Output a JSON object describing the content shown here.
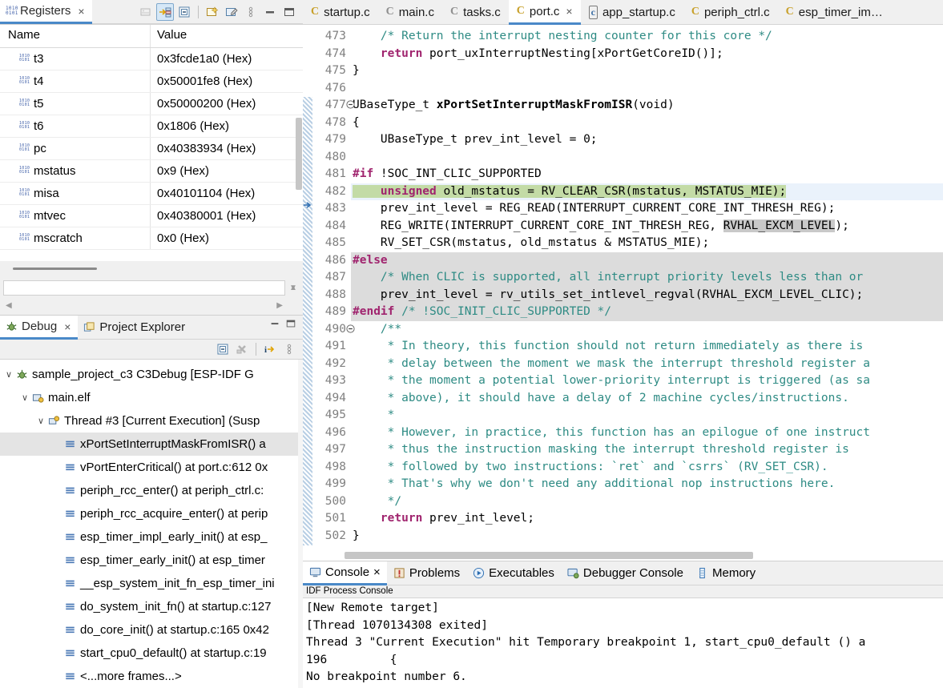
{
  "registers_view": {
    "tab_label": "Registers",
    "close_label": "×",
    "columns": {
      "name": "Name",
      "value": "Value"
    },
    "toolbar": [
      {
        "name": "collapse-registers-icon",
        "title": "Collapse All"
      },
      {
        "name": "show-type-names-icon",
        "title": "Show Type Names"
      },
      {
        "name": "collapse-all-icon",
        "title": "Collapse"
      },
      {
        "name": "new-register-group-icon",
        "title": "New Register Group"
      },
      {
        "name": "edit-register-group-icon",
        "title": "Edit Register Group"
      },
      {
        "name": "view-menu-icon",
        "title": "View Menu"
      },
      {
        "name": "minimize-icon",
        "title": "Minimize"
      },
      {
        "name": "maximize-icon",
        "title": "Maximize"
      }
    ],
    "rows": [
      {
        "name": "t3",
        "value": "0x3fcde1a0 (Hex)"
      },
      {
        "name": "t4",
        "value": "0x50001fe8 (Hex)"
      },
      {
        "name": "t5",
        "value": "0x50000200 (Hex)"
      },
      {
        "name": "t6",
        "value": "0x1806 (Hex)"
      },
      {
        "name": "pc",
        "value": "0x40383934 (Hex)"
      },
      {
        "name": "mstatus",
        "value": "0x9 (Hex)"
      },
      {
        "name": "misa",
        "value": "0x40101104 (Hex)"
      },
      {
        "name": "mtvec",
        "value": "0x40380001 (Hex)"
      },
      {
        "name": "mscratch",
        "value": "0x0 (Hex)"
      }
    ]
  },
  "debug_view": {
    "tabs": [
      {
        "label": "Debug",
        "active": true,
        "icon": "bug-icon",
        "closeable": true
      },
      {
        "label": "Project Explorer",
        "active": false,
        "icon": "project-explorer-icon",
        "closeable": false
      }
    ],
    "close_label": "×",
    "toolbar": [
      {
        "name": "collapse-all-icon",
        "title": "Collapse All"
      },
      {
        "name": "remove-terminated-icon",
        "title": "Remove All Terminated"
      },
      {
        "name": "step-info-icon",
        "title": "Instruction Stepping Mode"
      },
      {
        "name": "view-menu-icon",
        "title": "View Menu"
      }
    ],
    "minimize_label": "–",
    "maximize_label": "▭",
    "tree": [
      {
        "indent": 0,
        "twisty": "∨",
        "icon": "launch-config-icon",
        "label": "sample_project_c3 C3Debug [ESP-IDF G",
        "selected": false
      },
      {
        "indent": 1,
        "twisty": "∨",
        "icon": "process-icon",
        "label": "main.elf",
        "selected": false
      },
      {
        "indent": 2,
        "twisty": "∨",
        "icon": "thread-icon",
        "label": "Thread #3 [Current Execution] (Susp",
        "selected": false
      },
      {
        "indent": 3,
        "twisty": "",
        "icon": "stack-frame-icon",
        "label": "xPortSetInterruptMaskFromISR() a",
        "selected": true
      },
      {
        "indent": 3,
        "twisty": "",
        "icon": "stack-frame-icon",
        "label": "vPortEnterCritical() at port.c:612 0x",
        "selected": false
      },
      {
        "indent": 3,
        "twisty": "",
        "icon": "stack-frame-icon",
        "label": "periph_rcc_enter() at periph_ctrl.c:",
        "selected": false
      },
      {
        "indent": 3,
        "twisty": "",
        "icon": "stack-frame-icon",
        "label": "periph_rcc_acquire_enter() at perip",
        "selected": false
      },
      {
        "indent": 3,
        "twisty": "",
        "icon": "stack-frame-icon",
        "label": "esp_timer_impl_early_init() at esp_",
        "selected": false
      },
      {
        "indent": 3,
        "twisty": "",
        "icon": "stack-frame-icon",
        "label": "esp_timer_early_init() at esp_timer",
        "selected": false
      },
      {
        "indent": 3,
        "twisty": "",
        "icon": "stack-frame-icon",
        "label": "__esp_system_init_fn_esp_timer_ini",
        "selected": false
      },
      {
        "indent": 3,
        "twisty": "",
        "icon": "stack-frame-icon",
        "label": "do_system_init_fn() at startup.c:127",
        "selected": false
      },
      {
        "indent": 3,
        "twisty": "",
        "icon": "stack-frame-icon",
        "label": "do_core_init() at startup.c:165 0x42",
        "selected": false
      },
      {
        "indent": 3,
        "twisty": "",
        "icon": "stack-frame-icon",
        "label": "start_cpu0_default() at startup.c:19",
        "selected": false
      },
      {
        "indent": 3,
        "twisty": "",
        "icon": "stack-frame-icon",
        "label": "<...more frames...>",
        "selected": false
      }
    ]
  },
  "editor": {
    "tabs": [
      {
        "label": "startup.c",
        "icon": "c-source-icon",
        "icon_color": "y",
        "active": false,
        "closeable": false
      },
      {
        "label": "main.c",
        "icon": "c-source-icon",
        "icon_color": "g",
        "active": false,
        "closeable": false
      },
      {
        "label": "tasks.c",
        "icon": "c-source-icon",
        "icon_color": "g",
        "active": false,
        "closeable": false
      },
      {
        "label": "port.c",
        "icon": "c-source-icon",
        "icon_color": "y",
        "active": true,
        "closeable": true
      },
      {
        "label": "app_startup.c",
        "icon": "c-file-icon",
        "icon_color": "b",
        "active": false,
        "closeable": false
      },
      {
        "label": "periph_ctrl.c",
        "icon": "c-source-icon",
        "icon_color": "y",
        "active": false,
        "closeable": false
      },
      {
        "label": "esp_timer_im…",
        "icon": "c-source-icon",
        "icon_color": "y",
        "active": false,
        "closeable": false
      }
    ],
    "close_label": "×",
    "first_line": 473,
    "lines": [
      {
        "n": 473,
        "text": "    /* Return the interrupt nesting counter for this core */"
      },
      {
        "n": 474,
        "text": "    return port_uxInterruptNesting[xPortGetCoreID()];"
      },
      {
        "n": 475,
        "text": "}"
      },
      {
        "n": 476,
        "text": ""
      },
      {
        "n": 477,
        "text": "UBaseType_t xPortSetInterruptMaskFromISR(void)"
      },
      {
        "n": 478,
        "text": "{"
      },
      {
        "n": 479,
        "text": "    UBaseType_t prev_int_level = 0;"
      },
      {
        "n": 480,
        "text": ""
      },
      {
        "n": 481,
        "text": "#if !SOC_INT_CLIC_SUPPORTED"
      },
      {
        "n": 482,
        "text": "    unsigned old_mstatus = RV_CLEAR_CSR(mstatus, MSTATUS_MIE);"
      },
      {
        "n": 483,
        "text": "    prev_int_level = REG_READ(INTERRUPT_CURRENT_CORE_INT_THRESH_REG);"
      },
      {
        "n": 484,
        "text": "    REG_WRITE(INTERRUPT_CURRENT_CORE_INT_THRESH_REG, RVHAL_EXCM_LEVEL);"
      },
      {
        "n": 485,
        "text": "    RV_SET_CSR(mstatus, old_mstatus & MSTATUS_MIE);"
      },
      {
        "n": 486,
        "text": "#else"
      },
      {
        "n": 487,
        "text": "    /* When CLIC is supported, all interrupt priority levels less than or "
      },
      {
        "n": 488,
        "text": "    prev_int_level = rv_utils_set_intlevel_regval(RVHAL_EXCM_LEVEL_CLIC);"
      },
      {
        "n": 489,
        "text": "#endif /* !SOC_INIT_CLIC_SUPPORTED */"
      },
      {
        "n": 490,
        "text": "    /**"
      },
      {
        "n": 491,
        "text": "     * In theory, this function should not return immediately as there is "
      },
      {
        "n": 492,
        "text": "     * delay between the moment we mask the interrupt threshold register a"
      },
      {
        "n": 493,
        "text": "     * the moment a potential lower-priority interrupt is triggered (as sa"
      },
      {
        "n": 494,
        "text": "     * above), it should have a delay of 2 machine cycles/instructions."
      },
      {
        "n": 495,
        "text": "     *"
      },
      {
        "n": 496,
        "text": "     * However, in practice, this function has an epilogue of one instruct"
      },
      {
        "n": 497,
        "text": "     * thus the instruction masking the interrupt threshold register is"
      },
      {
        "n": 498,
        "text": "     * followed by two instructions: `ret` and `csrrs` (RV_SET_CSR)."
      },
      {
        "n": 499,
        "text": "     * That's why we don't need any additional nop instructions here."
      },
      {
        "n": 500,
        "text": "     */"
      },
      {
        "n": 501,
        "text": "    return prev_int_level;"
      },
      {
        "n": 502,
        "text": "}"
      }
    ],
    "execution_line": 482,
    "inactive_block": [
      486,
      489
    ],
    "occurrence_highlight": "RVHAL_EXCM_LEVEL",
    "fold_markers": [
      477,
      490
    ],
    "colors": {
      "exec_highlight": "#c3dba6",
      "inactive": "#dcdcdc",
      "selection": "#eaf2fb",
      "occurrence": "#c9c9c9",
      "keyword": "#a0246e",
      "comment": "#2e8b84",
      "linenumber": "#808080"
    }
  },
  "console_view": {
    "tabs": [
      {
        "label": "Console",
        "icon": "console-icon",
        "active": true,
        "closeable": true
      },
      {
        "label": "Problems",
        "icon": "problems-icon",
        "active": false,
        "closeable": false
      },
      {
        "label": "Executables",
        "icon": "executables-icon",
        "active": false,
        "closeable": false
      },
      {
        "label": "Debugger Console",
        "icon": "debugger-console-icon",
        "active": false,
        "closeable": false
      },
      {
        "label": "Memory",
        "icon": "memory-icon",
        "active": false,
        "closeable": false
      }
    ],
    "close_label": "×",
    "subtitle": "IDF Process Console",
    "output": "[New Remote target]\n[Thread 1070134308 exited]\nThread 3 \"Current Execution\" hit Temporary breakpoint 1, start_cpu0_default () a\n196\t    {\nNo breakpoint number 6."
  }
}
